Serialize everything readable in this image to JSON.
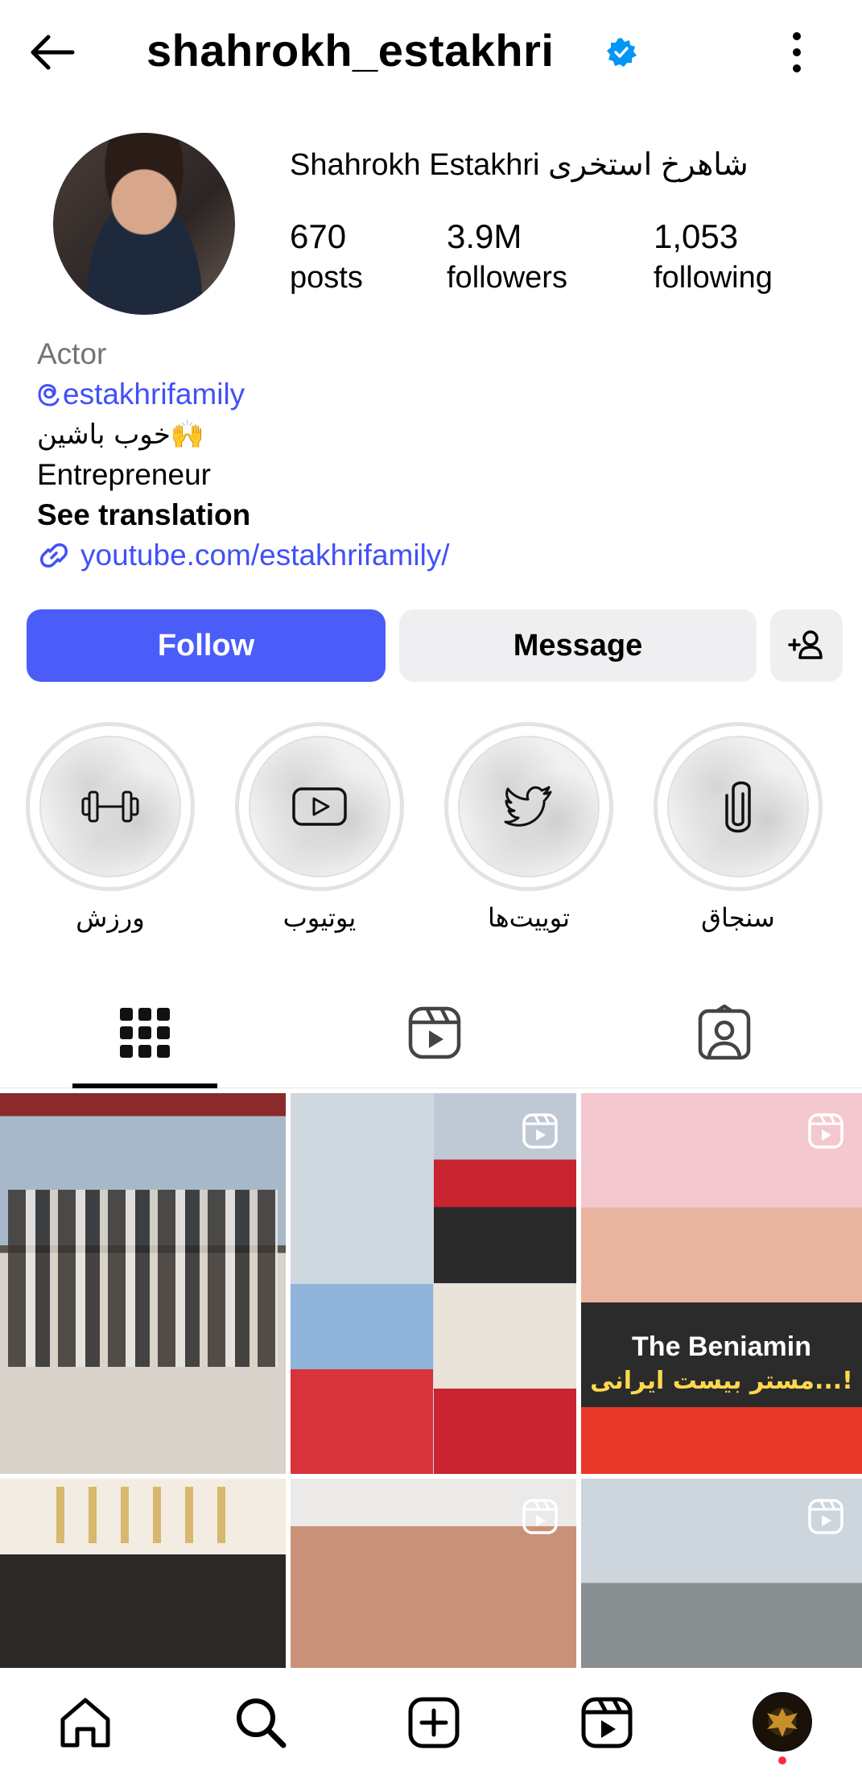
{
  "header": {
    "username": "shahrokh_estakhri",
    "verified": true
  },
  "profile": {
    "full_name": "Shahrokh Estakhri شاهرخ استخری",
    "stats": [
      {
        "value": "670",
        "label": "posts"
      },
      {
        "value": "3.9M",
        "label": "followers"
      },
      {
        "value": "1,053",
        "label": "following"
      }
    ],
    "category": "Actor",
    "threads_handle": "estakhrifamily",
    "bio_line1": "خوب باشین🙌",
    "bio_line2": "Entrepreneur",
    "see_translation": "See translation",
    "link": "youtube.com/estakhrifamily/"
  },
  "buttons": {
    "follow": "Follow",
    "message": "Message"
  },
  "highlights": [
    {
      "label": "ورزش",
      "icon": "dumbbell-icon"
    },
    {
      "label": "یوتیوب",
      "icon": "youtube-icon"
    },
    {
      "label": "توییت‌ها",
      "icon": "twitter-bird-icon"
    },
    {
      "label": "سنجاق",
      "icon": "paperclip-icon"
    }
  ],
  "tabs": [
    {
      "name": "posts-grid",
      "icon": "grid-icon",
      "active": true
    },
    {
      "name": "reels",
      "icon": "reels-icon",
      "active": false
    },
    {
      "name": "tagged",
      "icon": "tagged-user-icon",
      "active": false
    }
  ],
  "posts": [
    {
      "type": "photo"
    },
    {
      "type": "reel"
    },
    {
      "type": "reel",
      "text_line1": "The Beniamin",
      "text_line2": "مستر بیست ایرانی...!"
    },
    {
      "type": "photo"
    },
    {
      "type": "reel"
    },
    {
      "type": "reel"
    }
  ],
  "colors": {
    "accent": "#4a5df9",
    "link": "#4150f7",
    "verified": "#0095f6",
    "notification_dot": "#ff2b3a"
  }
}
